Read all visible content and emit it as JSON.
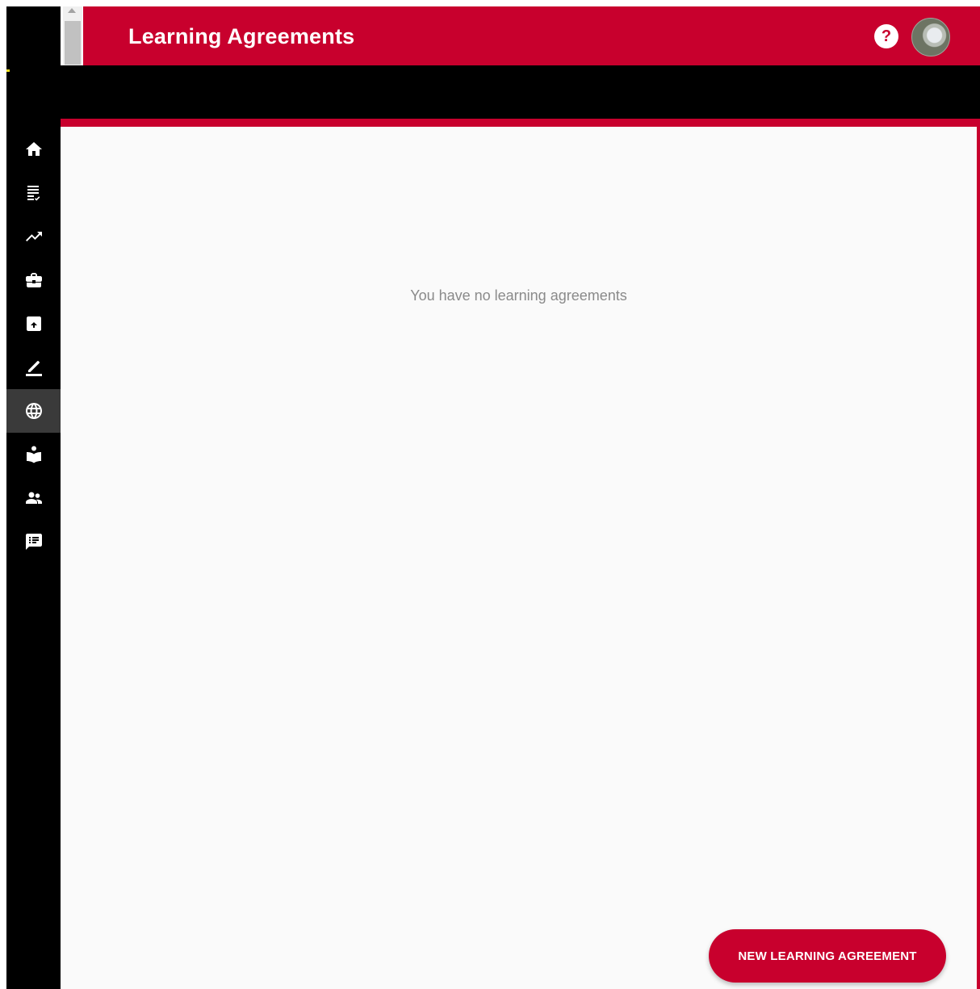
{
  "header": {
    "title": "Learning Agreements",
    "help_label": "?",
    "accent_color": "#c8002d"
  },
  "sidebar": {
    "items": [
      {
        "icon": "home-icon"
      },
      {
        "icon": "checklist-icon"
      },
      {
        "icon": "trending-up-icon"
      },
      {
        "icon": "briefcase-icon"
      },
      {
        "icon": "archive-icon"
      },
      {
        "icon": "edit-pencil-icon"
      },
      {
        "icon": "globe-icon",
        "active": true
      },
      {
        "icon": "reading-person-icon"
      },
      {
        "icon": "people-icon"
      },
      {
        "icon": "feedback-list-icon"
      }
    ]
  },
  "main": {
    "empty_message": "You have no learning agreements",
    "new_button_label": "NEW LEARNING AGREEMENT"
  }
}
